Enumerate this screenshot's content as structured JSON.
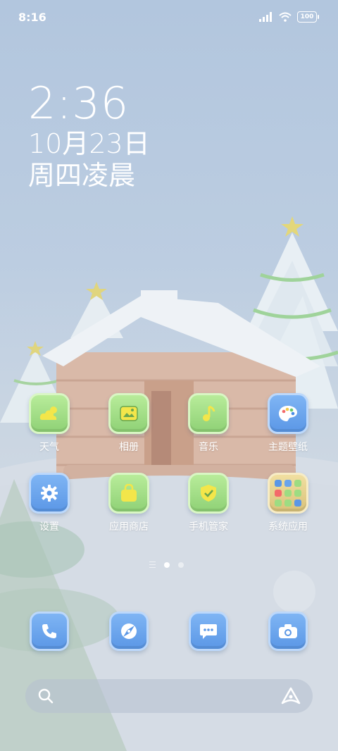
{
  "status_bar": {
    "time": "8:16",
    "battery": "100"
  },
  "clock": {
    "time": "2:36",
    "date": "10月23日",
    "weekday_period": "周四凌晨"
  },
  "apps_row1": [
    {
      "label": "天气",
      "icon": "weather-icon",
      "color": "green"
    },
    {
      "label": "相册",
      "icon": "gallery-icon",
      "color": "green"
    },
    {
      "label": "音乐",
      "icon": "music-icon",
      "color": "green"
    },
    {
      "label": "主题壁纸",
      "icon": "palette-icon",
      "color": "blue"
    }
  ],
  "apps_row2": [
    {
      "label": "设置",
      "icon": "settings-icon",
      "color": "blue"
    },
    {
      "label": "应用商店",
      "icon": "shopping-bag-icon",
      "color": "green"
    },
    {
      "label": "手机管家",
      "icon": "shield-check-icon",
      "color": "green"
    },
    {
      "label": "系统应用",
      "icon": "folder-icon",
      "color": "gold"
    }
  ],
  "dock": [
    {
      "icon": "phone-icon"
    },
    {
      "icon": "browser-icon"
    },
    {
      "icon": "messages-icon"
    },
    {
      "icon": "camera-icon"
    }
  ],
  "page_indicator": {
    "pages": 2,
    "current": 1
  },
  "colors": {
    "icon_green": "#9ddc82",
    "icon_blue": "#6aa4ec",
    "folder_gold": "#e5d18c"
  }
}
